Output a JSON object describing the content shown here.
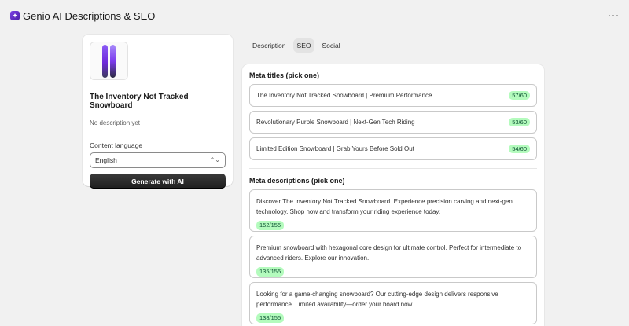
{
  "app": {
    "title": "Genio AI Descriptions & SEO",
    "more_label": "···"
  },
  "product": {
    "title": "The Inventory Not Tracked Snowboard",
    "description": "No description yet"
  },
  "language": {
    "label": "Content language",
    "selected": "English"
  },
  "generate": {
    "label": "Generate with AI"
  },
  "tabs": [
    {
      "label": "Description",
      "active": false
    },
    {
      "label": "SEO",
      "active": true
    },
    {
      "label": "Social",
      "active": false
    }
  ],
  "seo": {
    "titles_heading": "Meta titles (pick one)",
    "titles": [
      {
        "text": "The Inventory Not Tracked Snowboard | Premium Performance",
        "count": "57/60"
      },
      {
        "text": "Revolutionary Purple Snowboard | Next-Gen Tech Riding",
        "count": "53/60"
      },
      {
        "text": "Limited Edition Snowboard | Grab Yours Before Sold Out",
        "count": "54/60"
      }
    ],
    "descriptions_heading": "Meta descriptions (pick one)",
    "descriptions": [
      {
        "text": "Discover The Inventory Not Tracked Snowboard. Experience precision carving and next-gen technology. Shop now and transform your riding experience today.",
        "count": "152/155"
      },
      {
        "text": "Premium snowboard with hexagonal core design for ultimate control. Perfect for intermediate to advanced riders. Explore our innovation.",
        "count": "135/155"
      },
      {
        "text": "Looking for a game-changing snowboard? Our cutting-edge design delivers responsive performance. Limited availability—order your board now.",
        "count": "138/155"
      }
    ]
  },
  "colors": {
    "badge_bg": "#b4fbbd",
    "badge_text": "#0c5132",
    "primary_button": "#1f1f1f",
    "app_icon": "#6d28d9"
  }
}
